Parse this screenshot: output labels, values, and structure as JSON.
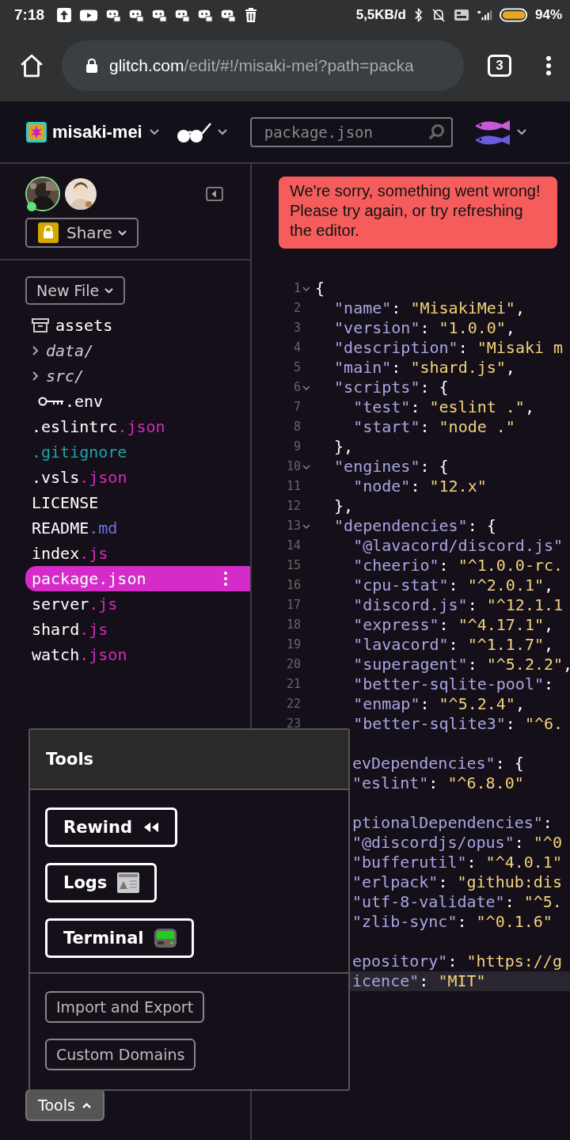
{
  "status_bar": {
    "time": "7:18",
    "speed": "5,5KB/d",
    "battery": "94%"
  },
  "browser": {
    "url_host": "glitch.com",
    "url_path": "/edit/#!/misaki-mei?path=packa",
    "tab_count": "3"
  },
  "header": {
    "project": "misaki-mei",
    "search": {
      "placeholder": "package.json"
    }
  },
  "sidebar": {
    "share": "Share",
    "new_file": "New File",
    "files": [
      {
        "kind": "asset",
        "name": "assets",
        "selected": false
      },
      {
        "kind": "folder",
        "name": "data/",
        "selected": false
      },
      {
        "kind": "folder",
        "name": "src/",
        "selected": false
      },
      {
        "kind": "env",
        "name": ".env",
        "selected": false
      },
      {
        "kind": "file",
        "name": ".eslintrc",
        "ext": ".json",
        "color": "#d42bb8",
        "selected": false
      },
      {
        "kind": "file",
        "ext": ".gitignore",
        "color": "#1fa3a8",
        "selected": false
      },
      {
        "kind": "file",
        "name": ".vsls",
        "ext": ".json",
        "color": "#d42bb8",
        "selected": false
      },
      {
        "kind": "file",
        "name": "LICENSE",
        "selected": false
      },
      {
        "kind": "file",
        "name": "README",
        "ext": ".md",
        "color": "#6b72e6",
        "selected": false
      },
      {
        "kind": "file",
        "name": "index",
        "ext": ".js",
        "color": "#d42bb8",
        "selected": false
      },
      {
        "kind": "file",
        "name": "package.json",
        "selected": true
      },
      {
        "kind": "file",
        "name": "server",
        "ext": ".js",
        "color": "#d42bb8",
        "selected": false
      },
      {
        "kind": "file",
        "name": "shard",
        "ext": ".js",
        "color": "#d42bb8",
        "selected": false
      },
      {
        "kind": "file",
        "name": "watch",
        "ext": ".json",
        "color": "#d42bb8",
        "selected": false
      }
    ],
    "tools_button": "Tools"
  },
  "error_toast": "We're sorry, something went wrong! Please try again, or try refreshing the editor.",
  "editor": {
    "lines": [
      {
        "num": "1",
        "fold": true,
        "parts": [
          {
            "kind": "punct",
            "text": "{"
          }
        ]
      },
      {
        "num": "2",
        "fold": false,
        "parts": [
          {
            "kind": "key",
            "text": "\"name\""
          },
          {
            "kind": "punct",
            "text": ": "
          },
          {
            "kind": "value",
            "text": "\"MisakiMei\""
          },
          {
            "kind": "punct",
            "text": ","
          }
        ]
      },
      {
        "num": "3",
        "fold": false,
        "parts": [
          {
            "kind": "key",
            "text": "\"version\""
          },
          {
            "kind": "punct",
            "text": ": "
          },
          {
            "kind": "value",
            "text": "\"1.0.0\""
          },
          {
            "kind": "punct",
            "text": ","
          }
        ]
      },
      {
        "num": "4",
        "fold": false,
        "parts": [
          {
            "kind": "key",
            "text": "\"description\""
          },
          {
            "kind": "punct",
            "text": ": "
          },
          {
            "kind": "value",
            "text": "\"Misaki m"
          }
        ]
      },
      {
        "num": "5",
        "fold": false,
        "parts": [
          {
            "kind": "key",
            "text": "\"main\""
          },
          {
            "kind": "punct",
            "text": ": "
          },
          {
            "kind": "value",
            "text": "\"shard.js\""
          },
          {
            "kind": "punct",
            "text": ","
          }
        ]
      },
      {
        "num": "6",
        "fold": true,
        "parts": [
          {
            "kind": "key",
            "text": "\"scripts\""
          },
          {
            "kind": "punct",
            "text": ": {"
          }
        ]
      },
      {
        "num": "7",
        "fold": false,
        "parts": [
          {
            "kind": "key",
            "text": "\"test\""
          },
          {
            "kind": "punct",
            "text": ": "
          },
          {
            "kind": "value",
            "text": "\"eslint .\""
          },
          {
            "kind": "punct",
            "text": ","
          }
        ]
      },
      {
        "num": "8",
        "fold": false,
        "parts": [
          {
            "kind": "key",
            "text": "\"start\""
          },
          {
            "kind": "punct",
            "text": ": "
          },
          {
            "kind": "value",
            "text": "\"node .\""
          }
        ]
      },
      {
        "num": "9",
        "fold": false,
        "parts": [
          {
            "kind": "punct",
            "text": "},"
          }
        ]
      },
      {
        "num": "10",
        "fold": true,
        "parts": [
          {
            "kind": "key",
            "text": "\"engines\""
          },
          {
            "kind": "punct",
            "text": ": {"
          }
        ]
      },
      {
        "num": "11",
        "fold": false,
        "parts": [
          {
            "kind": "key",
            "text": "\"node\""
          },
          {
            "kind": "punct",
            "text": ": "
          },
          {
            "kind": "value",
            "text": "\"12.x\""
          }
        ]
      },
      {
        "num": "12",
        "fold": false,
        "parts": [
          {
            "kind": "punct",
            "text": "},"
          }
        ]
      },
      {
        "num": "13",
        "fold": true,
        "parts": [
          {
            "kind": "key",
            "text": "\"dependencies\""
          },
          {
            "kind": "punct",
            "text": ": {"
          }
        ]
      },
      {
        "num": "14",
        "fold": false,
        "parts": [
          {
            "kind": "key",
            "text": "\"@lavacord/discord.js\""
          }
        ]
      },
      {
        "num": "15",
        "fold": false,
        "parts": [
          {
            "kind": "key",
            "text": "\"cheerio\""
          },
          {
            "kind": "punct",
            "text": ": "
          },
          {
            "kind": "value",
            "text": "\"^1.0.0-rc."
          }
        ]
      },
      {
        "num": "16",
        "fold": false,
        "parts": [
          {
            "kind": "key",
            "text": "\"cpu-stat\""
          },
          {
            "kind": "punct",
            "text": ": "
          },
          {
            "kind": "value",
            "text": "\"^2.0.1\""
          },
          {
            "kind": "punct",
            "text": ","
          }
        ]
      },
      {
        "num": "17",
        "fold": false,
        "parts": [
          {
            "kind": "key",
            "text": "\"discord.js\""
          },
          {
            "kind": "punct",
            "text": ": "
          },
          {
            "kind": "value",
            "text": "\"^12.1.1"
          }
        ]
      },
      {
        "num": "18",
        "fold": false,
        "parts": [
          {
            "kind": "key",
            "text": "\"express\""
          },
          {
            "kind": "punct",
            "text": ": "
          },
          {
            "kind": "value",
            "text": "\"^4.17.1\""
          },
          {
            "kind": "punct",
            "text": ","
          }
        ]
      },
      {
        "num": "19",
        "fold": false,
        "parts": [
          {
            "kind": "key",
            "text": "\"lavacord\""
          },
          {
            "kind": "punct",
            "text": ": "
          },
          {
            "kind": "value",
            "text": "\"^1.1.7\""
          },
          {
            "kind": "punct",
            "text": ","
          }
        ]
      },
      {
        "num": "20",
        "fold": false,
        "parts": [
          {
            "kind": "key",
            "text": "\"superagent\""
          },
          {
            "kind": "punct",
            "text": ": "
          },
          {
            "kind": "value",
            "text": "\"^5.2.2\""
          },
          {
            "kind": "punct",
            "text": ","
          }
        ]
      },
      {
        "num": "21",
        "fold": false,
        "parts": [
          {
            "kind": "key",
            "text": "\"better-sqlite-pool\""
          },
          {
            "kind": "punct",
            "text": ":"
          }
        ]
      },
      {
        "num": "22",
        "fold": false,
        "parts": [
          {
            "kind": "key",
            "text": "\"enmap\""
          },
          {
            "kind": "punct",
            "text": ": "
          },
          {
            "kind": "value",
            "text": "\"^5.2.4\""
          },
          {
            "kind": "punct",
            "text": ","
          }
        ]
      },
      {
        "num": "23",
        "fold": false,
        "parts": [
          {
            "kind": "key",
            "text": "\"better-sqlite3\""
          },
          {
            "kind": "punct",
            "text": ": "
          },
          {
            "kind": "value",
            "text": "\"^6."
          }
        ]
      }
    ],
    "covered_lines": [
      {
        "active": false
      },
      {
        "active": false,
        "parts": [
          {
            "kind": "key",
            "text": "evDependencies\""
          },
          {
            "kind": "punct",
            "text": ": {"
          }
        ]
      },
      {
        "active": false,
        "parts": [
          {
            "kind": "key",
            "text": "\"eslint\""
          },
          {
            "kind": "punct",
            "text": ": "
          },
          {
            "kind": "value",
            "text": "\"^6.8.0\""
          }
        ]
      },
      {
        "active": false
      },
      {
        "active": false,
        "parts": [
          {
            "kind": "key",
            "text": "ptionalDependencies\""
          },
          {
            "kind": "punct",
            "text": ":"
          }
        ]
      },
      {
        "active": false,
        "parts": [
          {
            "kind": "key",
            "text": "\"@discordjs/opus\""
          },
          {
            "kind": "punct",
            "text": ": "
          },
          {
            "kind": "value",
            "text": "\"^0"
          }
        ]
      },
      {
        "active": false,
        "parts": [
          {
            "kind": "key",
            "text": "\"bufferutil\""
          },
          {
            "kind": "punct",
            "text": ": "
          },
          {
            "kind": "value",
            "text": "\"^4.0.1\""
          }
        ]
      },
      {
        "active": false,
        "parts": [
          {
            "kind": "key",
            "text": "\"erlpack\""
          },
          {
            "kind": "punct",
            "text": ": "
          },
          {
            "kind": "value",
            "text": "\"github:dis"
          }
        ]
      },
      {
        "active": false,
        "parts": [
          {
            "kind": "key",
            "text": "\"utf-8-validate\""
          },
          {
            "kind": "punct",
            "text": ": "
          },
          {
            "kind": "value",
            "text": "\"^5."
          }
        ]
      },
      {
        "active": false,
        "parts": [
          {
            "kind": "key",
            "text": "\"zlib-sync\""
          },
          {
            "kind": "punct",
            "text": ": "
          },
          {
            "kind": "value",
            "text": "\"^0.1.6\""
          }
        ]
      },
      {
        "active": false
      },
      {
        "active": false,
        "parts": [
          {
            "kind": "key",
            "text": "epository\""
          },
          {
            "kind": "punct",
            "text": ": "
          },
          {
            "kind": "value",
            "text": "\"https://g"
          }
        ]
      },
      {
        "active": true,
        "parts": [
          {
            "kind": "key",
            "text": "icence\""
          },
          {
            "kind": "punct",
            "text": ": "
          },
          {
            "kind": "value",
            "text": "\"MIT\""
          }
        ]
      }
    ]
  },
  "tools_panel": {
    "title": "Tools",
    "primary": [
      {
        "kind": "rewind",
        "label": "Rewind"
      },
      {
        "kind": "logs",
        "label": "Logs"
      },
      {
        "kind": "terminal",
        "label": "Terminal"
      }
    ],
    "secondary": [
      "Import and Export",
      "Custom Domains"
    ]
  }
}
